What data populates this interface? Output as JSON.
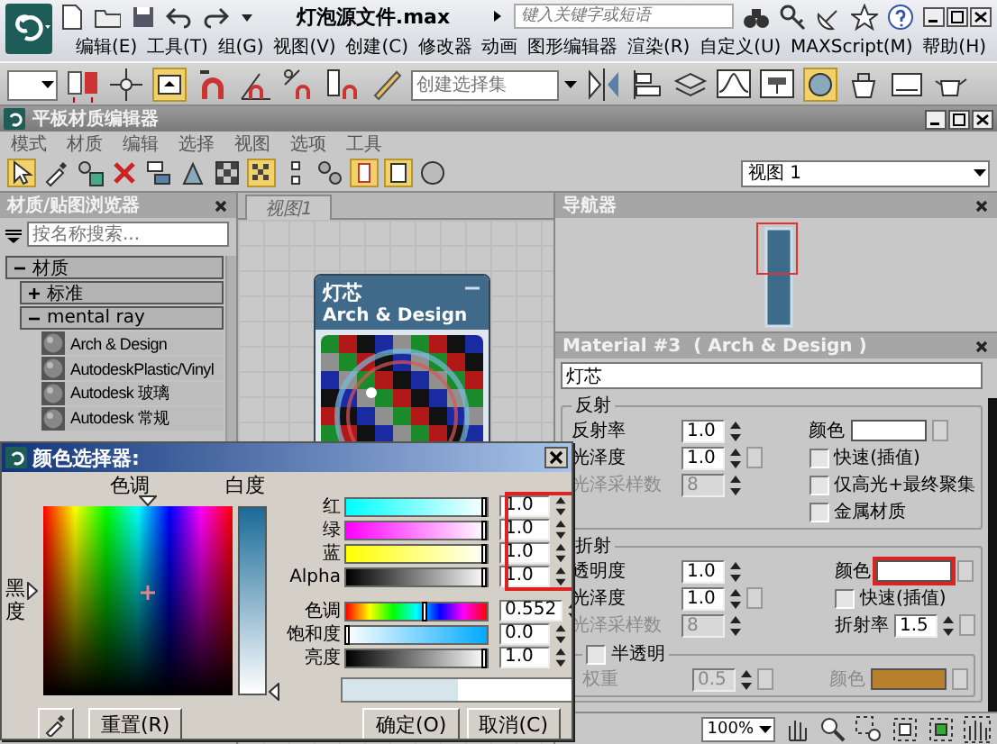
{
  "app": {
    "title": "灯泡源文件.max",
    "search": {
      "placeholder": "键入关键字或短语"
    },
    "menu": [
      "编辑(E)",
      "工具(T)",
      "组(G)",
      "视图(V)",
      "创建(C)",
      "修改器",
      "动画",
      "图形编辑器",
      "渲染(R)",
      "自定义(U)",
      "MAXScript(M)",
      "帮助(H)"
    ]
  },
  "main_toolbar": {
    "selection_set": {
      "placeholder": "创建选择集"
    }
  },
  "editor": {
    "title": "平板材质编辑器",
    "menu": [
      "模式",
      "材质",
      "编辑",
      "选择",
      "视图",
      "选项",
      "工具"
    ],
    "view_select": "视图 1"
  },
  "browser": {
    "title": "材质/贴图浏览器",
    "search": {
      "placeholder": "按名称搜索..."
    },
    "tree": [
      {
        "label": "材质",
        "expanded": true,
        "children": [
          {
            "label": "标准",
            "expanded": false
          },
          {
            "label": "mental ray",
            "expanded": true,
            "children": [
              {
                "label": "Arch & Design"
              },
              {
                "label": "AutodeskPlastic/Vinyl"
              },
              {
                "label": "Autodesk 玻璃"
              },
              {
                "label": "Autodesk 常规"
              }
            ]
          }
        ]
      }
    ]
  },
  "view": {
    "tab": "视图1",
    "node": {
      "title": "灯芯",
      "subtitle": "Arch & Design"
    }
  },
  "navigator": {
    "title": "导航器"
  },
  "props": {
    "title": "Material #3  ( Arch & Design )",
    "name": "灯芯",
    "groups": [
      {
        "title": "反射",
        "left": [
          {
            "label": "反射率",
            "value": "1.0",
            "disabled": false,
            "map": false
          },
          {
            "label": "光泽度",
            "value": "1.0",
            "disabled": false,
            "map": true
          },
          {
            "label": "光泽采样数",
            "value": "8",
            "disabled": true,
            "map": false
          }
        ],
        "right": [
          {
            "kind": "color",
            "label": "颜色",
            "color": "#ffffff",
            "highlighted": false
          },
          {
            "kind": "checkbox",
            "label": "快速(插值)",
            "checked": false
          },
          {
            "kind": "checkbox",
            "label": "仅高光+最终聚集",
            "checked": false
          },
          {
            "kind": "checkbox",
            "label": "金属材质",
            "checked": false
          }
        ]
      },
      {
        "title": "折射",
        "left": [
          {
            "label": "透明度",
            "value": "1.0",
            "disabled": false,
            "map": false
          },
          {
            "label": "光泽度",
            "value": "1.0",
            "disabled": false,
            "map": true
          },
          {
            "label": "光泽采样数",
            "value": "8",
            "disabled": true,
            "map": false
          }
        ],
        "right": [
          {
            "kind": "color",
            "label": "颜色",
            "color": "#ffffff",
            "highlighted": true
          },
          {
            "kind": "checkbox",
            "label": "快速(插值)",
            "checked": false
          },
          {
            "kind": "spinner",
            "label": "折射率",
            "value": "1.5"
          }
        ],
        "translucency": {
          "label": "半透明",
          "checked": false,
          "weight": {
            "label": "权重",
            "value": "0.5",
            "disabled": true
          },
          "color": {
            "label": "颜色",
            "color": "#b8802c",
            "disabled": true
          }
        }
      }
    ]
  },
  "zoom": "100%",
  "color_picker": {
    "title": "颜色选择器:",
    "hue_label": "色调",
    "whiteness_label": "白度",
    "blackness_label": "黑度",
    "rgb_highlighted": true,
    "channels": [
      {
        "kind": "red",
        "label": "红",
        "value": "1.0",
        "level": 1
      },
      {
        "kind": "green",
        "label": "绿",
        "value": "1.0",
        "level": 1
      },
      {
        "kind": "blue",
        "label": "蓝",
        "value": "1.0",
        "level": 1
      },
      {
        "kind": "alpha",
        "label": "Alpha",
        "value": "1.0",
        "level": 1
      }
    ],
    "hsv": [
      {
        "kind": "hue",
        "label": "色调",
        "value": "0.552",
        "level": 0.552
      },
      {
        "kind": "saturation",
        "label": "饱和度",
        "value": "0.0",
        "level": 0
      },
      {
        "kind": "value",
        "label": "亮度",
        "value": "1.0",
        "level": 1
      }
    ],
    "buttons": [
      {
        "kind": "reset",
        "label": "重置(R)"
      },
      {
        "kind": "ok",
        "label": "确定(O)"
      },
      {
        "kind": "cancel",
        "label": "取消(C)"
      }
    ]
  }
}
